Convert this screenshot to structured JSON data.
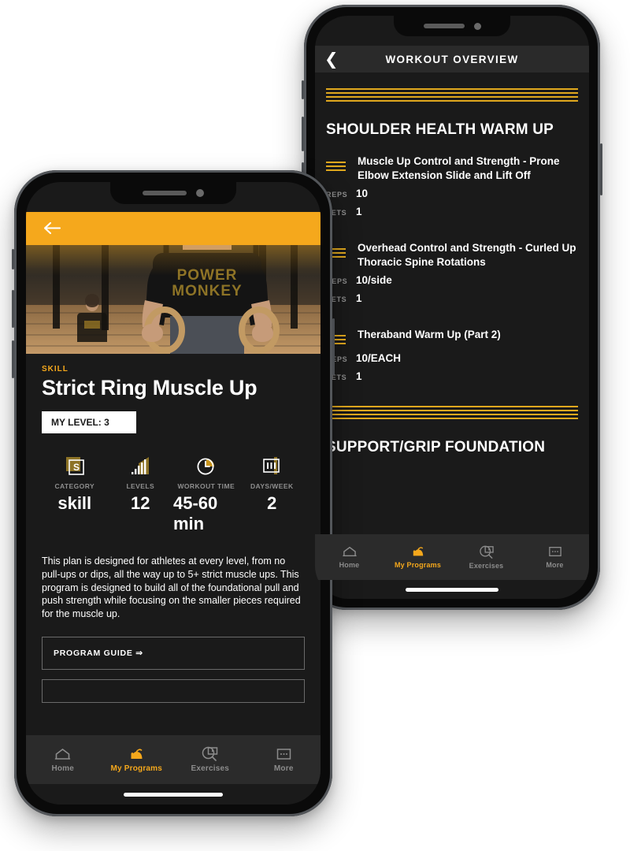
{
  "theme": {
    "accent": "#f5a81c",
    "rule": "#e0a81e",
    "bg": "#1a1a1a",
    "bar": "#2b2b2b",
    "muted": "#8e8e8e"
  },
  "back_phone": {
    "appbar": {
      "title": "WORKOUT OVERVIEW",
      "back_icon": "chevron-left-icon"
    },
    "sections": [
      {
        "heading": "SHOULDER HEALTH WARM UP",
        "exercises": [
          {
            "name": "Muscle Up Control and Strength - Prone Elbow Extension Slide and Lift Off",
            "reps_label": "REPS",
            "reps": "10",
            "sets_label": "SETS",
            "sets": "1"
          },
          {
            "name": "Overhead Control and Strength - Curled Up Thoracic Spine Rotations",
            "reps_label": "REPS",
            "reps": "10/side",
            "sets_label": "SETS",
            "sets": "1"
          },
          {
            "name": "Theraband Warm Up (Part 2)",
            "reps_label": "REPS",
            "reps": "10/EACH",
            "sets_label": "SETS",
            "sets": "1"
          }
        ]
      },
      {
        "heading": "SUPPORT/GRIP FOUNDATION",
        "exercises": []
      }
    ],
    "tabs": [
      {
        "label": "Home",
        "icon": "home-icon",
        "active": false
      },
      {
        "label": "My Programs",
        "icon": "flexed-biceps-icon",
        "active": true
      },
      {
        "label": "Exercises",
        "icon": "video-search-icon",
        "active": false
      },
      {
        "label": "More",
        "icon": "ellipsis-box-icon",
        "active": false
      }
    ]
  },
  "front_phone": {
    "hero": {
      "back_icon": "arrow-left-icon",
      "alt": "athletes hanging from gymnastic rings"
    },
    "kicker": "SKILL",
    "title": "Strict Ring Muscle Up",
    "level_badge": "MY LEVEL: 3",
    "stats": [
      {
        "label": "CATEGORY",
        "value": "skill",
        "icon": "skill-badge-icon"
      },
      {
        "label": "LEVELS",
        "value": "12",
        "icon": "bar-chart-icon"
      },
      {
        "label": "WORKOUT TIME",
        "value": "45-60 min",
        "icon": "clock-icon"
      },
      {
        "label": "DAYS/WEEK",
        "value": "2",
        "icon": "calendar-icon"
      }
    ],
    "description": "This plan is designed for athletes at every level, from no pull-ups or dips, all the way up to 5+ strict muscle ups. This program is designed to build all of the foundational pull and push strength while focusing on the smaller pieces required for the muscle up.",
    "program_guide_button": "PROGRAM GUIDE ⇒",
    "tabs": [
      {
        "label": "Home",
        "icon": "home-icon",
        "active": false
      },
      {
        "label": "My Programs",
        "icon": "flexed-biceps-icon",
        "active": true
      },
      {
        "label": "Exercises",
        "icon": "video-search-icon",
        "active": false
      },
      {
        "label": "More",
        "icon": "ellipsis-box-icon",
        "active": false
      }
    ]
  }
}
